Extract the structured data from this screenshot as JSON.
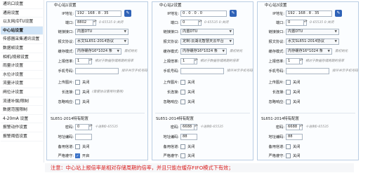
{
  "sidebar": {
    "items": [
      {
        "label": "通讯口设置"
      },
      {
        "label": "通用设置"
      },
      {
        "label": "以太网/DTU设置"
      },
      {
        "label": "中心站设置"
      },
      {
        "label": "传感器采集通讯设置"
      },
      {
        "label": "数据帧设置"
      },
      {
        "label": "相机/视频设置"
      },
      {
        "label": "雨量计设置"
      },
      {
        "label": "水位计设置"
      },
      {
        "label": "流量计设置"
      },
      {
        "label": "闸位计设置"
      },
      {
        "label": "流速补偿/限制"
      },
      {
        "label": "数据范围限制"
      },
      {
        "label": "4-20mA 设置"
      },
      {
        "label": "报警动作设置"
      },
      {
        "label": "报警阈值设置"
      }
    ],
    "active_index": 3
  },
  "panels": [
    {
      "title": "中心站1设置",
      "ip_label": "IP地址:",
      "ip_value": "192 . 168 . 8 . 35",
      "port_label": "端口:",
      "port_value": "8802",
      "port_hint": "0-65535 0:关闭",
      "link_label": "链接接口:",
      "link_value": "内置DTU",
      "protocol_label": "报文协议:",
      "protocol_value": "水文SL651-2014协议",
      "cache_label": "缓存模式:",
      "cache_value": "内存缓存16*1024 条",
      "cache_hint": "需初始化",
      "report_label": "上报倍率:",
      "report_value": "1",
      "report_hint": "相对于数据存储周期的倍率",
      "phone_label": "手机号码:",
      "phone_value": "",
      "phone_hint": "接环并示手机号码",
      "upload_label": "上传图片:",
      "upload_text": "关闭",
      "upload_on": false,
      "longconn_label": "长连接:",
      "longconn_text": "关闭",
      "longconn_note": "(需使协议使用时使用)",
      "longconn_on": false,
      "ignore_label": "忽略响应:",
      "ignore_text": "关闭",
      "ignore_on": false,
      "sl_title": "SL651-2014特有配置",
      "addr_label": "密码:",
      "addr_value": "0",
      "addr_hint": "十进制0-65535",
      "station_label": "地址编码:",
      "station_value": "",
      "backup_label": "备用信道:",
      "backup_text": "关闭",
      "backup_on": false,
      "strict_label": "严格遵守:",
      "strict_text": "开启",
      "strict_on": true
    },
    {
      "title": "中心站2设置",
      "ip_label": "IP地址:",
      "ip_value": "0 . 0 . 0 . 0",
      "port_label": "端口:",
      "port_value": "0",
      "port_hint": "0-65535 0:关闭",
      "link_label": "链接接口:",
      "link_value": "内置DTU",
      "protocol_label": "报文协议:",
      "protocol_value": "定制:云湖北智慧天云平台",
      "cache_label": "缓存模式:",
      "cache_value": "内存缓存16*1024 条",
      "cache_hint": "需初始化",
      "report_label": "上报倍率:",
      "report_value": "1",
      "report_hint": "相对于数据存储周期的倍率",
      "phone_label": "手机号码:",
      "phone_value": "",
      "phone_hint": "接环并示手机号码",
      "upload_label": "上传图片:",
      "upload_text": "关闭",
      "upload_on": false,
      "longconn_label": "长连接:",
      "longconn_text": "关闭",
      "longconn_note": "",
      "longconn_on": false,
      "ignore_label": "忽略响应:",
      "ignore_text": "关闭",
      "ignore_on": false,
      "sl_title": "SL651-2014特有配置",
      "addr_label": "密码:",
      "addr_value": "6688",
      "addr_hint": "十进制0-65535",
      "station_label": "地址编码:",
      "station_value": "88",
      "backup_label": "备用信道:",
      "backup_text": "关闭",
      "backup_on": false,
      "strict_label": "严格遵守:",
      "strict_text": "关闭",
      "strict_on": false
    },
    {
      "title": "中心站3设置",
      "ip_label": "IP地址:",
      "ip_value": "192 . 168 . 8 . 35",
      "port_label": "端口:",
      "port_value": "0",
      "port_hint": "0-65535 0:关闭",
      "link_label": "链接接口:",
      "link_value": "内置DTU",
      "protocol_label": "报文协议:",
      "protocol_value": "水文SL651-2014协议",
      "cache_label": "缓存模式:",
      "cache_value": "内存缓存16*1024 条",
      "cache_hint": "需初始化",
      "report_label": "上报倍率:",
      "report_value": "1",
      "report_hint": "相对于数据存储周期的倍率",
      "phone_label": "手机号码:",
      "phone_value": "",
      "phone_hint": "接环并示手机号码",
      "upload_label": "上传图片:",
      "upload_text": "关闭",
      "upload_on": false,
      "longconn_label": "长连接:",
      "longconn_text": "关闭",
      "longconn_note": "",
      "longconn_on": false,
      "ignore_label": "忽略响应:",
      "ignore_text": "关闭",
      "ignore_on": false,
      "sl_title": "SL651-2014特有配置",
      "addr_label": "密码:",
      "addr_value": "6688",
      "addr_hint": "十进制0-65535",
      "station_label": "地址编码:",
      "station_value": "88",
      "backup_label": "备用信道:",
      "backup_text": "关闭",
      "backup_on": false,
      "strict_label": "严格遵守:",
      "strict_text": "关闭",
      "strict_on": false
    }
  ],
  "notice": "注意：中心站上报倍率是相对存储周期的倍率，并且只能在缓存FIFO模式下有效；",
  "colors": {
    "accent": "#2f62b7",
    "notice": "#d91a1a",
    "active_nav": "#cfe3f6"
  }
}
